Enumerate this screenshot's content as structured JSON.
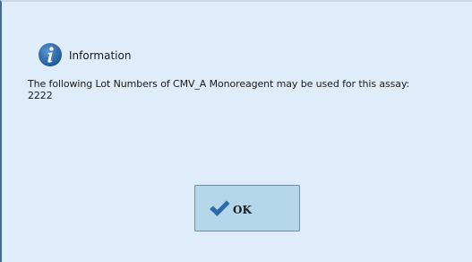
{
  "dialog": {
    "title": "Information",
    "icon": "info-icon",
    "message_line1": "The following Lot Numbers of CMV_A Monoreagent may be used for this assay:",
    "message_line2": "2222"
  },
  "ok_button": {
    "label": "OK",
    "icon": "checkmark-icon"
  },
  "colors": {
    "background": "#dfecf9",
    "button": "#b5d5e8",
    "accent": "#2d6aa8"
  }
}
